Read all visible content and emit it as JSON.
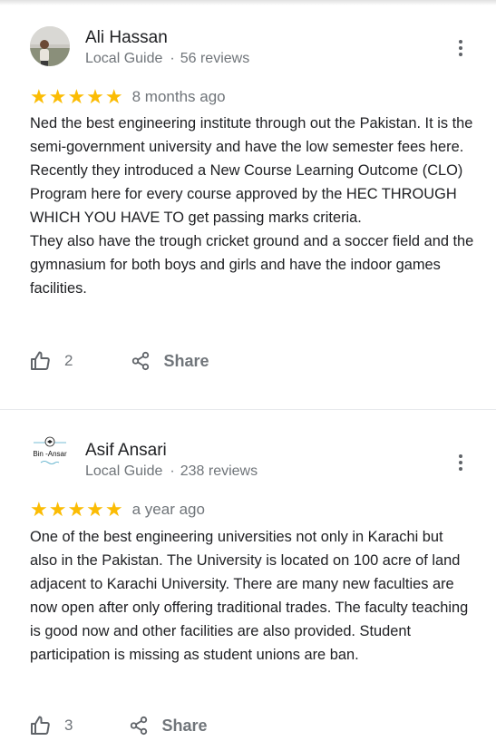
{
  "reviews": [
    {
      "name": "Ali Hassan",
      "role": "Local Guide",
      "reviews_count": "56 reviews",
      "stars": "★★★★★",
      "rating": 5,
      "time": "8 months ago",
      "text": [
        "Ned the best engineering institute through out the Pakistan. It is the semi-government university and have the low semester fees here. Recently they introduced a New Course Learning Outcome (CLO) Program here for every course approved by the HEC THROUGH WHICH YOU HAVE TO get passing marks criteria.",
        "They also have the trough cricket ground and a soccer field and the gymnasium for both boys and girls and have the indoor games facilities."
      ],
      "likes": "2",
      "share_label": "Share"
    },
    {
      "name": "Asif Ansari",
      "role": "Local Guide",
      "reviews_count": "238 reviews",
      "stars": "★★★★★",
      "rating": 5,
      "time": "a year ago",
      "avatar_logo_text": "Bin -Ansar",
      "text": [
        "One of the best engineering universities not only in Karachi but also in the Pakistan. The University is located on 100 acre of land adjacent to Karachi University. There are many new faculties are now open after only offering traditional trades. The faculty teaching is good now and other facilities are also provided. Student participation is missing as student unions are ban."
      ],
      "likes": "3",
      "share_label": "Share"
    }
  ],
  "separator": "·",
  "colors": {
    "star": "#fbbc04",
    "secondary_text": "#70757a",
    "primary_text": "#202124"
  },
  "icons": {
    "like": "thumb-up-icon",
    "share": "share-icon",
    "more": "more-vert-icon"
  }
}
